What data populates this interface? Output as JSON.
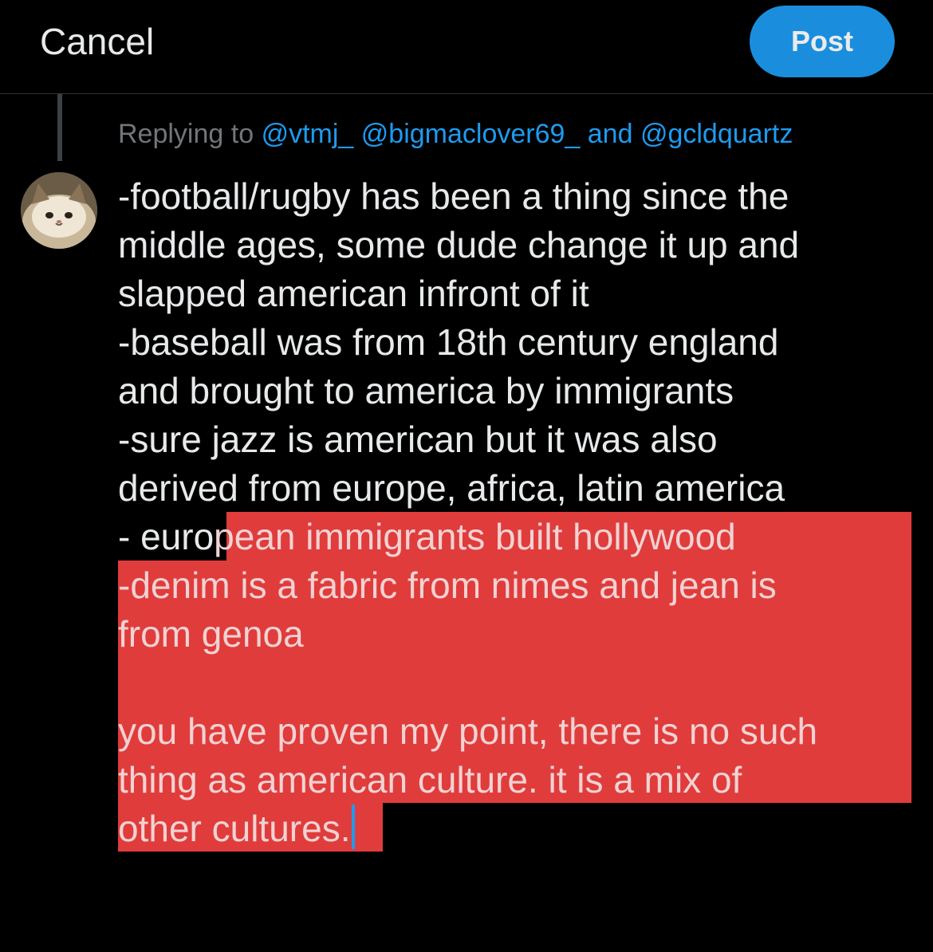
{
  "header": {
    "cancel_label": "Cancel",
    "post_label": "Post"
  },
  "replying": {
    "prefix": "Replying to",
    "mention_1": "@vtmj_",
    "mention_2": "@bigmaclover69_",
    "conjunction": "and",
    "mention_3": "@gcldquartz"
  },
  "composer": {
    "lines": [
      "-football/rugby has been a thing since the",
      "middle ages, some dude change it up and",
      "slapped american infront of it",
      "-baseball was from 18th century england",
      "and brought to america by immigrants",
      "-sure jazz is american but it was also",
      "derived from europe, africa, latin america"
    ],
    "line_8_plain": "- euro",
    "line_8_selected": "pean immigrants built hollywood",
    "selected_lines": [
      "-denim is a fabric from nimes and jean is",
      "from genoa",
      "",
      "you have proven my point, there is no such",
      "thing as american culture. it is a mix of",
      "other cultures."
    ]
  },
  "colors": {
    "background": "#000000",
    "accent": "#1d9bf0",
    "selection": "#e03c3c",
    "text": "#e7e9ea",
    "muted": "#71767b"
  },
  "icons": {
    "avatar": "cat-avatar"
  }
}
